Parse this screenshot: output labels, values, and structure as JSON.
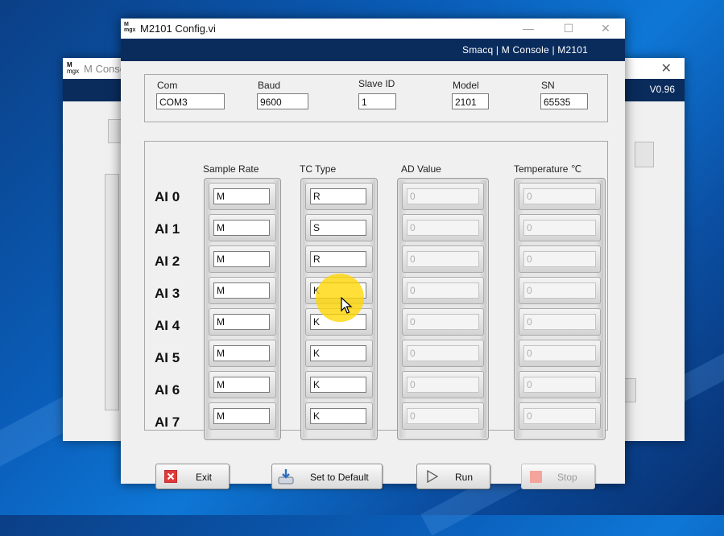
{
  "background_window": {
    "title": "M Console",
    "version": "V0.96",
    "close_glyph": "✕",
    "icon_text": "M\nmgx"
  },
  "window": {
    "title": "M2101 Config.vi",
    "icon_text": "M\nmgx",
    "minimize_glyph": "—",
    "maximize_glyph": "☐",
    "close_glyph": "✕",
    "brand": "Smacq | M Console | M2101"
  },
  "device": {
    "com_label": "Com",
    "com_value": "COM3",
    "baud_label": "Baud",
    "baud_value": "9600",
    "slave_label": "Slave ID",
    "slave_value": "1",
    "model_label": "Model",
    "model_value": "2101",
    "sn_label": "SN",
    "sn_value": "65535"
  },
  "columns": {
    "sample_rate": "Sample Rate",
    "tc_type": "TC Type",
    "ad_value": "AD Value",
    "temperature": "Temperature ℃"
  },
  "channels": [
    {
      "label": "AI 0",
      "sample_rate": "M",
      "tc_type": "R",
      "ad_value": "0",
      "temperature": "0"
    },
    {
      "label": "AI 1",
      "sample_rate": "M",
      "tc_type": "S",
      "ad_value": "0",
      "temperature": "0"
    },
    {
      "label": "AI 2",
      "sample_rate": "M",
      "tc_type": "R",
      "ad_value": "0",
      "temperature": "0"
    },
    {
      "label": "AI 3",
      "sample_rate": "M",
      "tc_type": "K",
      "ad_value": "0",
      "temperature": "0"
    },
    {
      "label": "AI 4",
      "sample_rate": "M",
      "tc_type": "K",
      "ad_value": "0",
      "temperature": "0"
    },
    {
      "label": "AI 5",
      "sample_rate": "M",
      "tc_type": "K",
      "ad_value": "0",
      "temperature": "0"
    },
    {
      "label": "AI 6",
      "sample_rate": "M",
      "tc_type": "K",
      "ad_value": "0",
      "temperature": "0"
    },
    {
      "label": "AI 7",
      "sample_rate": "M",
      "tc_type": "K",
      "ad_value": "0",
      "temperature": "0"
    }
  ],
  "buttons": {
    "exit": "Exit",
    "default": "Set to Default",
    "run": "Run",
    "stop": "Stop"
  },
  "colors": {
    "header_band": "#0a2c5c",
    "exit_icon": "#e03a3a",
    "stop_icon": "#f4a49a",
    "cursor_highlight": "#ffd600"
  }
}
